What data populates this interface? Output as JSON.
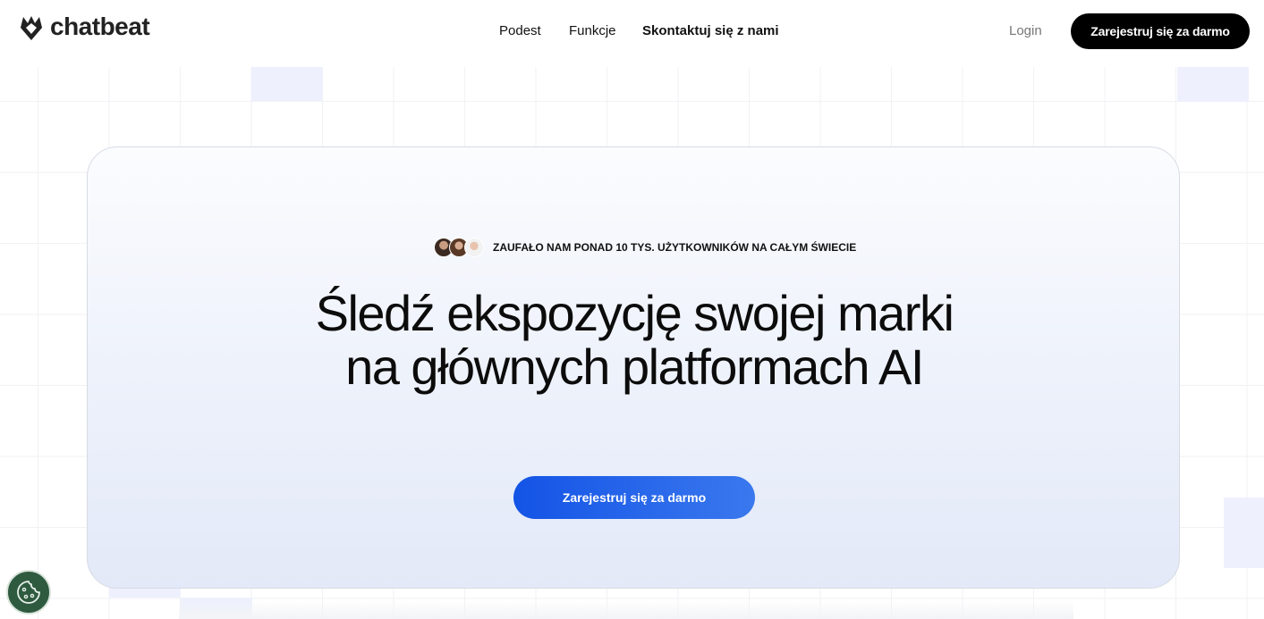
{
  "brand": {
    "name": "chatbeat",
    "logo_icon": "chatbeat-logo-icon"
  },
  "nav": {
    "items": [
      "Podest",
      "Funkcje",
      "Skontaktuj się z nami"
    ],
    "login": "Login",
    "signup": "Zarejestruj się za darmo"
  },
  "hero": {
    "trust_text": "ZAUFAŁO NAM PONAD 10 TYS. UŻYTKOWNIKÓW NA CAŁYM ŚWIECIE",
    "headline_line1": "Śledź ekspozycję swojej marki",
    "headline_line2": "na głównych platformach AI",
    "cta": "Zarejestruj się za darmo"
  },
  "cookie": {
    "icon": "cookie-icon"
  },
  "colors": {
    "accent_blue": "#1454e6",
    "dark_button": "#000000",
    "cookie_bg": "#2e5a40"
  }
}
